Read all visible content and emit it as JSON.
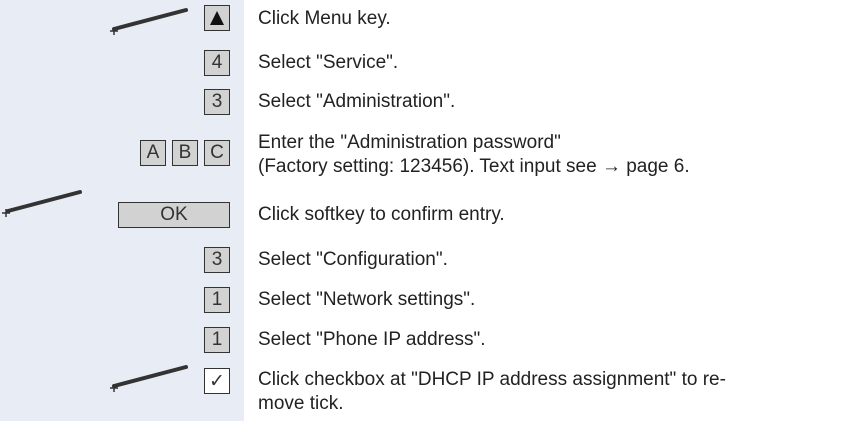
{
  "steps": [
    {
      "keys": [
        "▲"
      ],
      "pen": true,
      "text": "Click Menu key."
    },
    {
      "keys": [
        "4"
      ],
      "text": "Select \"Service\"."
    },
    {
      "keys": [
        "3"
      ],
      "text": "Select \"Administration\"."
    },
    {
      "keys": [
        "A",
        "B",
        "C"
      ],
      "text_line1": "Enter the \"Administration password\"",
      "text_line2": "(Factory setting: 123456). Text input see → page 6."
    },
    {
      "keys": [
        "OK"
      ],
      "pen": true,
      "text": "Click softkey to confirm entry."
    },
    {
      "keys": [
        "3"
      ],
      "text": "Select \"Configuration\"."
    },
    {
      "keys": [
        "1"
      ],
      "text": "Select \"Network settings\"."
    },
    {
      "keys": [
        "1"
      ],
      "text": "Select \"Phone IP address\"."
    },
    {
      "keys": [
        "✓"
      ],
      "pen": true,
      "text_line1": "Click checkbox at \"DHCP IP address assignment\" to re-",
      "text_line2": "move tick."
    }
  ],
  "icons": {
    "pen": "stylus-pen-icon",
    "menu": "up-triangle-icon",
    "checkbox": "checkmark-icon"
  },
  "colors": {
    "left_pane": "#e8ecf4",
    "key_fill": "#d2d2d2",
    "key_border": "#333333"
  }
}
